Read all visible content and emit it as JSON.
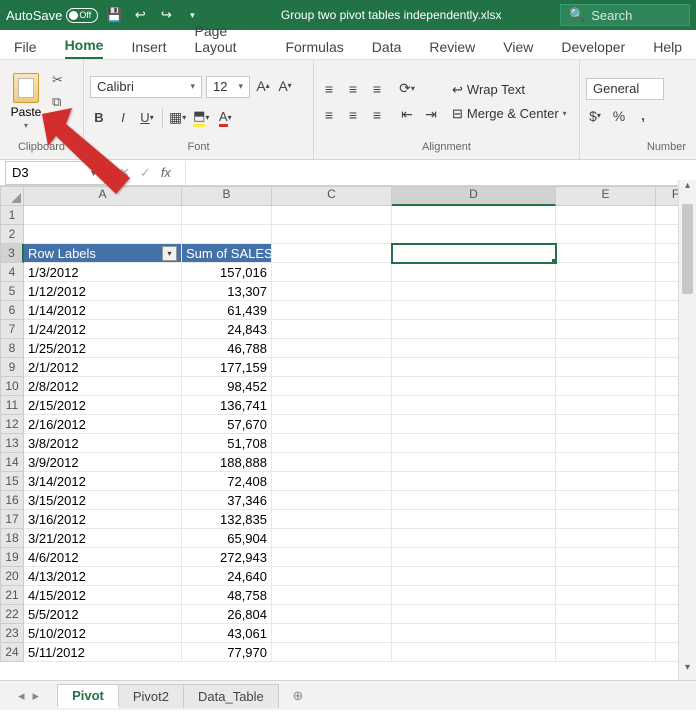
{
  "titlebar": {
    "autosave": "AutoSave",
    "autosave_state": "Off",
    "filename": "Group two pivot tables independently.xlsx",
    "search_placeholder": "Search"
  },
  "tabs": [
    "File",
    "Home",
    "Insert",
    "Page Layout",
    "Formulas",
    "Data",
    "Review",
    "View",
    "Developer",
    "Help"
  ],
  "active_tab": "Home",
  "ribbon": {
    "clipboard": {
      "paste": "Paste",
      "label": "Clipboard"
    },
    "font": {
      "name": "Calibri",
      "size": "12",
      "label": "Font"
    },
    "alignment": {
      "wrap": "Wrap Text",
      "merge": "Merge & Center",
      "label": "Alignment"
    },
    "number": {
      "format": "General",
      "label": "Number"
    }
  },
  "formula": {
    "cell_ref": "D3",
    "value": ""
  },
  "columns": [
    "A",
    "B",
    "C",
    "D",
    "E",
    "F"
  ],
  "selected_col": "D",
  "selected_row": 3,
  "pivot_headers": {
    "rows": "Row Labels",
    "vals": "Sum of SALES"
  },
  "rows": [
    {
      "n": 1
    },
    {
      "n": 2
    },
    {
      "n": 3,
      "header": true
    },
    {
      "n": 4,
      "a": "1/3/2012",
      "b": "157,016"
    },
    {
      "n": 5,
      "a": "1/12/2012",
      "b": "13,307"
    },
    {
      "n": 6,
      "a": "1/14/2012",
      "b": "61,439"
    },
    {
      "n": 7,
      "a": "1/24/2012",
      "b": "24,843"
    },
    {
      "n": 8,
      "a": "1/25/2012",
      "b": "46,788"
    },
    {
      "n": 9,
      "a": "2/1/2012",
      "b": "177,159"
    },
    {
      "n": 10,
      "a": "2/8/2012",
      "b": "98,452"
    },
    {
      "n": 11,
      "a": "2/15/2012",
      "b": "136,741"
    },
    {
      "n": 12,
      "a": "2/16/2012",
      "b": "57,670"
    },
    {
      "n": 13,
      "a": "3/8/2012",
      "b": "51,708"
    },
    {
      "n": 14,
      "a": "3/9/2012",
      "b": "188,888"
    },
    {
      "n": 15,
      "a": "3/14/2012",
      "b": "72,408"
    },
    {
      "n": 16,
      "a": "3/15/2012",
      "b": "37,346"
    },
    {
      "n": 17,
      "a": "3/16/2012",
      "b": "132,835"
    },
    {
      "n": 18,
      "a": "3/21/2012",
      "b": "65,904"
    },
    {
      "n": 19,
      "a": "4/6/2012",
      "b": "272,943"
    },
    {
      "n": 20,
      "a": "4/13/2012",
      "b": "24,640"
    },
    {
      "n": 21,
      "a": "4/15/2012",
      "b": "48,758"
    },
    {
      "n": 22,
      "a": "5/5/2012",
      "b": "26,804"
    },
    {
      "n": 23,
      "a": "5/10/2012",
      "b": "43,061"
    },
    {
      "n": 24,
      "a": "5/11/2012",
      "b": "77,970"
    }
  ],
  "sheets": [
    "Pivot",
    "Pivot2",
    "Data_Table"
  ],
  "active_sheet": "Pivot"
}
